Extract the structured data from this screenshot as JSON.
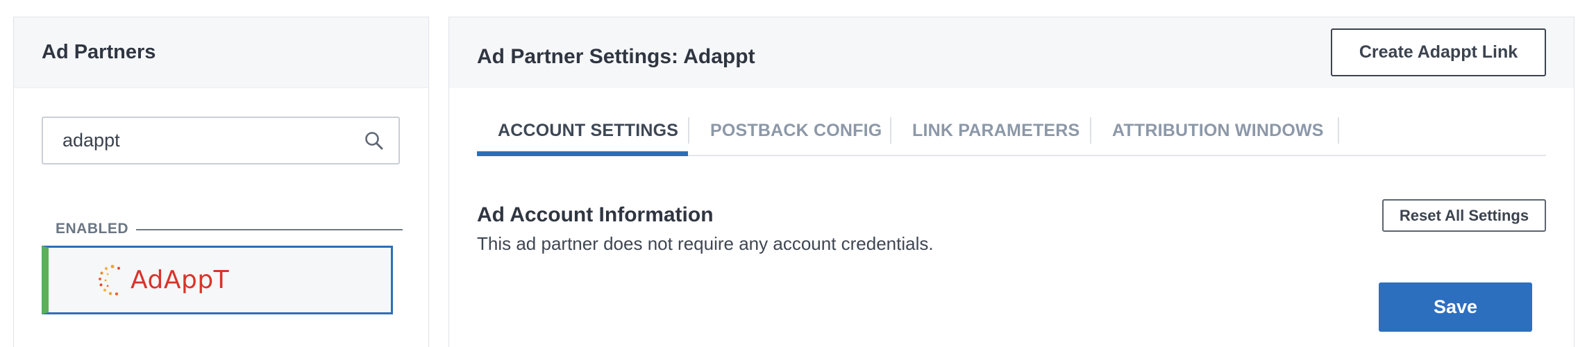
{
  "sidebar": {
    "title": "Ad Partners",
    "search": {
      "value": "adappt",
      "placeholder": "",
      "icon": "search-icon"
    },
    "section_label": "ENABLED",
    "partners": [
      {
        "name": "Adappt",
        "logo_text": "AdAppT",
        "status": "enabled"
      }
    ]
  },
  "main": {
    "title": "Ad Partner Settings: Adappt",
    "create_link_label": "Create Adappt Link",
    "tabs": [
      {
        "label": "ACCOUNT SETTINGS",
        "active": true
      },
      {
        "label": "POSTBACK CONFIG",
        "active": false
      },
      {
        "label": "LINK PARAMETERS",
        "active": false
      },
      {
        "label": "ATTRIBUTION WINDOWS",
        "active": false
      }
    ],
    "section": {
      "title": "Ad Account Information",
      "description": "This ad partner does not require any account credentials."
    },
    "reset_label": "Reset All Settings",
    "save_label": "Save"
  },
  "colors": {
    "accent": "#2c6fb8",
    "enabled": "#59b15a",
    "logo": "#d8342b",
    "panel_header": "#f6f7f9"
  }
}
